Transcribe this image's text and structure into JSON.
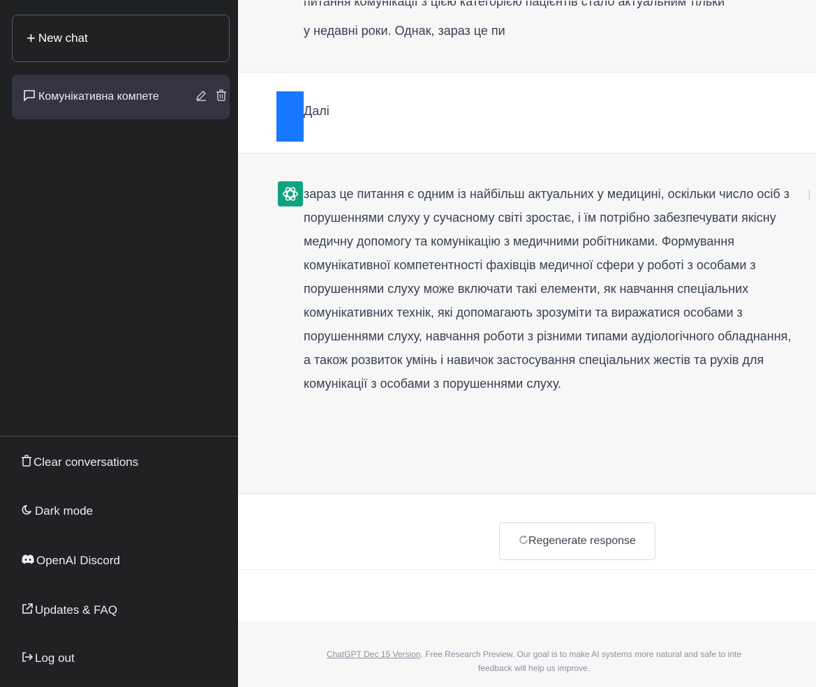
{
  "sidebar": {
    "new_chat_label": "New chat",
    "conversation_title": "Комунікативна компете",
    "links": {
      "clear": "Clear conversations",
      "dark_mode": "Dark mode",
      "discord": "OpenAI Discord",
      "updates": "Updates & FAQ",
      "logout": "Log out"
    }
  },
  "messages": {
    "prev_assistant_overflow": "питання комунікації з цією категорією пацієнтів стало актуальним тільки",
    "prev_assistant_tail": "у недавні роки. Однак, зараз це пи",
    "user_text": "Далі",
    "assistant_text": "зараз це питання є одним із найбільш актуальних у медицині, оскільки число осіб з порушеннями слуху у сучасному світі зростає, і їм потрібно забезпечувати якісну медичну допомогу та комунікацію з медичними робітниками. Формування комунікативної компетентності фахівців медичної сфери у роботі з особами з порушеннями слуху може включати такі елементи, як навчання спеціальних комунікативних технік, які допомагають зрозуміти та виражатися особами з порушеннями слуху, навчання роботи з різними типами аудіологічного обладнання, а також розвиток умінь і навичок застосування спеціальних жестів та рухів для комунікації з особами з порушеннями слуху."
  },
  "regenerate_label": "Regenerate response",
  "footer": {
    "version_link": "ChatGPT Dec 15 Version",
    "text_line1": ". Free Research Preview. Our goal is to make AI systems more natural and safe to inte",
    "text_line2": "feedback will help us improve."
  },
  "colors": {
    "sidebar_bg": "#202123",
    "selected_conv_bg": "#343541",
    "user_avatar": "#1677ff",
    "assistant_avatar": "#10a37f",
    "message_alt_bg": "#f7f7f8"
  }
}
